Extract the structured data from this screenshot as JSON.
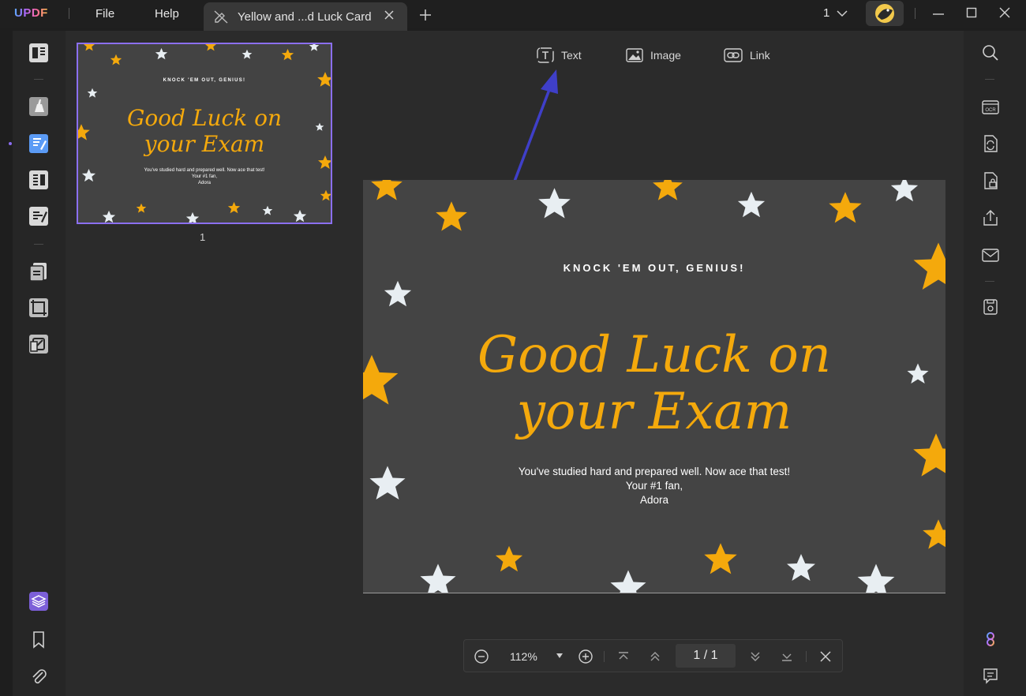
{
  "app": {
    "logo": "UPDF",
    "menu": [
      "File",
      "Help"
    ],
    "tab_title": "Yellow and ...d Luck Card",
    "page_count": "1"
  },
  "edit_toolbar": {
    "text_label": "Text",
    "image_label": "Image",
    "link_label": "Link"
  },
  "document": {
    "headline": "KNOCK 'EM OUT, GENIUS!",
    "script_line1": "Good Luck on",
    "script_line2": "your Exam",
    "body_line1": "You've studied hard and prepared well. Now ace that test!",
    "body_line2": "Your #1 fan,",
    "body_line3": "Adora"
  },
  "thumbnail": {
    "page_label": "1"
  },
  "zoombar": {
    "zoom": "112%",
    "page_indicator": "1  /  1"
  },
  "colors": {
    "accent": "#8b6ff0",
    "star_yellow": "#f4a90c",
    "star_white": "#e8eef2",
    "card_bg": "#444444",
    "arrow": "#3f3fc8"
  }
}
